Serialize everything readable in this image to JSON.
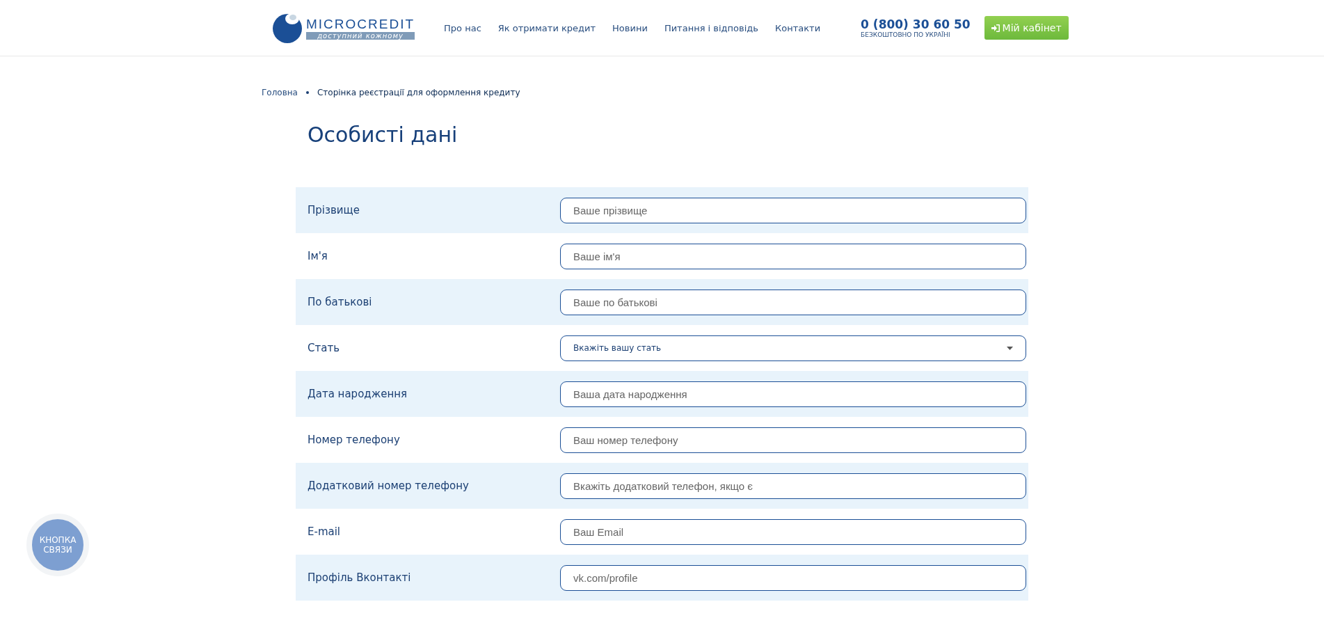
{
  "header": {
    "logo": {
      "name": "MICROCREDIT",
      "tagline": "доступний кожному"
    },
    "nav": [
      {
        "label": "Про нас"
      },
      {
        "label": "Як отримати кредит"
      },
      {
        "label": "Новини"
      },
      {
        "label": "Питання і відповідь"
      },
      {
        "label": "Контакти"
      }
    ],
    "phone": {
      "number": "0 (800) 30 60 50",
      "note": "БЕЗКОШТОВНО ПО УКРАЇНІ"
    },
    "cabinet_button": "Мій кабінет"
  },
  "breadcrumb": [
    "Головна",
    "Сторінка реєстрації для оформлення кредиту"
  ],
  "title": "Особисті дані",
  "form": [
    {
      "label": "Прізвище",
      "kind": "input",
      "placeholder": "Ваше прізвище"
    },
    {
      "label": "Ім'я",
      "kind": "input",
      "placeholder": "Ваше ім'я"
    },
    {
      "label": "По батькові",
      "kind": "input",
      "placeholder": "Ваше по батькові"
    },
    {
      "label": "Стать",
      "kind": "select",
      "value": "Вкажіть вашу стать"
    },
    {
      "label": "Дата народження",
      "kind": "input",
      "placeholder": "Ваша дата народження"
    },
    {
      "label": "Номер телефону",
      "kind": "input",
      "placeholder": "Ваш номер телефону"
    },
    {
      "label": "Додатковий номер телефону",
      "kind": "input",
      "placeholder": "Вкажіть додатковий телефон, якщо є"
    },
    {
      "label": "E-mail",
      "kind": "input",
      "placeholder": "Ваш Email"
    },
    {
      "label": "Профіль Вконтакті",
      "kind": "input",
      "placeholder": "vk.com/profile"
    }
  ],
  "contact_button": [
    "КНОПКА",
    "СВЯЗИ"
  ]
}
